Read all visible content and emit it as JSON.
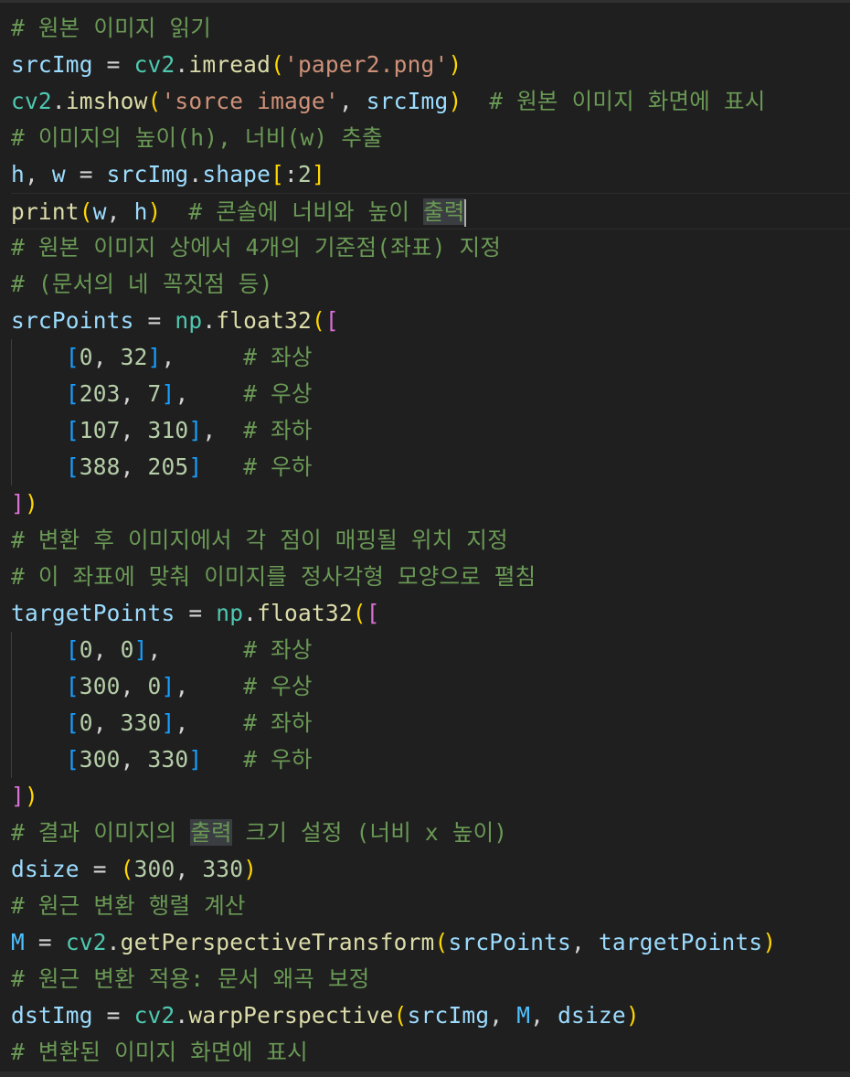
{
  "lines": [
    [
      {
        "t": "# 원본 이미지 읽기",
        "c": "comment"
      }
    ],
    [
      {
        "t": "srcImg",
        "c": "var"
      },
      {
        "t": " = ",
        "c": "op"
      },
      {
        "t": "cv2",
        "c": "mod"
      },
      {
        "t": ".",
        "c": "op"
      },
      {
        "t": "imread",
        "c": "func"
      },
      {
        "t": "(",
        "c": "p1"
      },
      {
        "t": "'paper2.png'",
        "c": "str"
      },
      {
        "t": ")",
        "c": "p1"
      }
    ],
    [
      {
        "t": "cv2",
        "c": "mod"
      },
      {
        "t": ".",
        "c": "op"
      },
      {
        "t": "imshow",
        "c": "func"
      },
      {
        "t": "(",
        "c": "p1"
      },
      {
        "t": "'sorce image'",
        "c": "str"
      },
      {
        "t": ", ",
        "c": "op"
      },
      {
        "t": "srcImg",
        "c": "var"
      },
      {
        "t": ")",
        "c": "p1"
      },
      {
        "t": "  ",
        "c": "op"
      },
      {
        "t": "# 원본 이미지 화면에 표시",
        "c": "comment"
      }
    ],
    [
      {
        "t": "# 이미지의 높이(h), 너비(w) 추출",
        "c": "comment"
      }
    ],
    [
      {
        "t": "h",
        "c": "var"
      },
      {
        "t": ", ",
        "c": "op"
      },
      {
        "t": "w",
        "c": "var"
      },
      {
        "t": " = ",
        "c": "op"
      },
      {
        "t": "srcImg",
        "c": "var"
      },
      {
        "t": ".",
        "c": "op"
      },
      {
        "t": "shape",
        "c": "var"
      },
      {
        "t": "[",
        "c": "p1"
      },
      {
        "t": ":",
        "c": "op"
      },
      {
        "t": "2",
        "c": "num"
      },
      {
        "t": "]",
        "c": "p1"
      }
    ],
    [
      {
        "t": "print",
        "c": "func"
      },
      {
        "t": "(",
        "c": "p1"
      },
      {
        "t": "w",
        "c": "var"
      },
      {
        "t": ", ",
        "c": "op"
      },
      {
        "t": "h",
        "c": "var"
      },
      {
        "t": ")",
        "c": "p1"
      },
      {
        "t": "  ",
        "c": "op"
      },
      {
        "t": "# 콘솔에 너비와 높이 ",
        "c": "comment"
      },
      {
        "t": "출력",
        "c": "comment",
        "hl": true
      },
      {
        "t": "",
        "c": "cursor"
      }
    ],
    [
      {
        "t": "# 원본 이미지 상에서 4개의 기준점(좌표) 지정",
        "c": "comment"
      }
    ],
    [
      {
        "t": "# (문서의 네 꼭짓점 등)",
        "c": "comment"
      }
    ],
    [
      {
        "t": "srcPoints",
        "c": "var"
      },
      {
        "t": " = ",
        "c": "op"
      },
      {
        "t": "np",
        "c": "mod"
      },
      {
        "t": ".",
        "c": "op"
      },
      {
        "t": "float32",
        "c": "func"
      },
      {
        "t": "(",
        "c": "p1"
      },
      {
        "t": "[",
        "c": "p2"
      }
    ],
    [
      {
        "t": "    ",
        "c": "op"
      },
      {
        "t": "[",
        "c": "p3"
      },
      {
        "t": "0",
        "c": "num"
      },
      {
        "t": ", ",
        "c": "op"
      },
      {
        "t": "32",
        "c": "num"
      },
      {
        "t": "]",
        "c": "p3"
      },
      {
        "t": ",     ",
        "c": "op"
      },
      {
        "t": "# 좌상",
        "c": "comment"
      }
    ],
    [
      {
        "t": "    ",
        "c": "op"
      },
      {
        "t": "[",
        "c": "p3"
      },
      {
        "t": "203",
        "c": "num"
      },
      {
        "t": ", ",
        "c": "op"
      },
      {
        "t": "7",
        "c": "num"
      },
      {
        "t": "]",
        "c": "p3"
      },
      {
        "t": ",    ",
        "c": "op"
      },
      {
        "t": "# 우상",
        "c": "comment"
      }
    ],
    [
      {
        "t": "    ",
        "c": "op"
      },
      {
        "t": "[",
        "c": "p3"
      },
      {
        "t": "107",
        "c": "num"
      },
      {
        "t": ", ",
        "c": "op"
      },
      {
        "t": "310",
        "c": "num"
      },
      {
        "t": "]",
        "c": "p3"
      },
      {
        "t": ",  ",
        "c": "op"
      },
      {
        "t": "# 좌하",
        "c": "comment"
      }
    ],
    [
      {
        "t": "    ",
        "c": "op"
      },
      {
        "t": "[",
        "c": "p3"
      },
      {
        "t": "388",
        "c": "num"
      },
      {
        "t": ", ",
        "c": "op"
      },
      {
        "t": "205",
        "c": "num"
      },
      {
        "t": "]",
        "c": "p3"
      },
      {
        "t": "   ",
        "c": "op"
      },
      {
        "t": "# 우하",
        "c": "comment"
      }
    ],
    [
      {
        "t": "]",
        "c": "p2"
      },
      {
        "t": ")",
        "c": "p1"
      }
    ],
    [
      {
        "t": "# 변환 후 이미지에서 각 점이 매핑될 위치 지정",
        "c": "comment"
      }
    ],
    [
      {
        "t": "# 이 좌표에 맞춰 이미지를 정사각형 모양으로 펼침",
        "c": "comment"
      }
    ],
    [
      {
        "t": "targetPoints",
        "c": "var"
      },
      {
        "t": " = ",
        "c": "op"
      },
      {
        "t": "np",
        "c": "mod"
      },
      {
        "t": ".",
        "c": "op"
      },
      {
        "t": "float32",
        "c": "func"
      },
      {
        "t": "(",
        "c": "p1"
      },
      {
        "t": "[",
        "c": "p2"
      }
    ],
    [
      {
        "t": "    ",
        "c": "op"
      },
      {
        "t": "[",
        "c": "p3"
      },
      {
        "t": "0",
        "c": "num"
      },
      {
        "t": ", ",
        "c": "op"
      },
      {
        "t": "0",
        "c": "num"
      },
      {
        "t": "]",
        "c": "p3"
      },
      {
        "t": ",      ",
        "c": "op"
      },
      {
        "t": "# 좌상",
        "c": "comment"
      }
    ],
    [
      {
        "t": "    ",
        "c": "op"
      },
      {
        "t": "[",
        "c": "p3"
      },
      {
        "t": "300",
        "c": "num"
      },
      {
        "t": ", ",
        "c": "op"
      },
      {
        "t": "0",
        "c": "num"
      },
      {
        "t": "]",
        "c": "p3"
      },
      {
        "t": ",    ",
        "c": "op"
      },
      {
        "t": "# 우상",
        "c": "comment"
      }
    ],
    [
      {
        "t": "    ",
        "c": "op"
      },
      {
        "t": "[",
        "c": "p3"
      },
      {
        "t": "0",
        "c": "num"
      },
      {
        "t": ", ",
        "c": "op"
      },
      {
        "t": "330",
        "c": "num"
      },
      {
        "t": "]",
        "c": "p3"
      },
      {
        "t": ",    ",
        "c": "op"
      },
      {
        "t": "# 좌하",
        "c": "comment"
      }
    ],
    [
      {
        "t": "    ",
        "c": "op"
      },
      {
        "t": "[",
        "c": "p3"
      },
      {
        "t": "300",
        "c": "num"
      },
      {
        "t": ", ",
        "c": "op"
      },
      {
        "t": "330",
        "c": "num"
      },
      {
        "t": "]",
        "c": "p3"
      },
      {
        "t": "   ",
        "c": "op"
      },
      {
        "t": "# 우하",
        "c": "comment"
      }
    ],
    [
      {
        "t": "]",
        "c": "p2"
      },
      {
        "t": ")",
        "c": "p1"
      }
    ],
    [
      {
        "t": "# 결과 이미지의 ",
        "c": "comment"
      },
      {
        "t": "출력",
        "c": "comment",
        "hl": true
      },
      {
        "t": " 크기 설정 (너비 x 높이)",
        "c": "comment"
      }
    ],
    [
      {
        "t": "dsize",
        "c": "var"
      },
      {
        "t": " = ",
        "c": "op"
      },
      {
        "t": "(",
        "c": "p1"
      },
      {
        "t": "300",
        "c": "num"
      },
      {
        "t": ", ",
        "c": "op"
      },
      {
        "t": "330",
        "c": "num"
      },
      {
        "t": ")",
        "c": "p1"
      }
    ],
    [
      {
        "t": "# 원근 변환 행렬 계산",
        "c": "comment"
      }
    ],
    [
      {
        "t": "M",
        "c": "const"
      },
      {
        "t": " = ",
        "c": "op"
      },
      {
        "t": "cv2",
        "c": "mod"
      },
      {
        "t": ".",
        "c": "op"
      },
      {
        "t": "getPerspectiveTransform",
        "c": "func"
      },
      {
        "t": "(",
        "c": "p1"
      },
      {
        "t": "srcPoints",
        "c": "var"
      },
      {
        "t": ", ",
        "c": "op"
      },
      {
        "t": "targetPoints",
        "c": "var"
      },
      {
        "t": ")",
        "c": "p1"
      }
    ],
    [
      {
        "t": "# 원근 변환 적용: 문서 왜곡 보정",
        "c": "comment"
      }
    ],
    [
      {
        "t": "dstImg",
        "c": "var"
      },
      {
        "t": " = ",
        "c": "op"
      },
      {
        "t": "cv2",
        "c": "mod"
      },
      {
        "t": ".",
        "c": "op"
      },
      {
        "t": "warpPerspective",
        "c": "func"
      },
      {
        "t": "(",
        "c": "p1"
      },
      {
        "t": "srcImg",
        "c": "var"
      },
      {
        "t": ", ",
        "c": "op"
      },
      {
        "t": "M",
        "c": "const"
      },
      {
        "t": ", ",
        "c": "op"
      },
      {
        "t": "dsize",
        "c": "var"
      },
      {
        "t": ")",
        "c": "p1"
      }
    ],
    [
      {
        "t": "# 변환된 이미지 화면에 표시",
        "c": "comment"
      }
    ]
  ],
  "current_line": 5,
  "colors": {
    "background": "#1f1f1f",
    "comment": "#6a9955",
    "variable": "#9cdcfe",
    "function": "#dcdcaa",
    "module": "#4ec9b0",
    "string": "#ce9178",
    "number": "#b5cea8"
  }
}
